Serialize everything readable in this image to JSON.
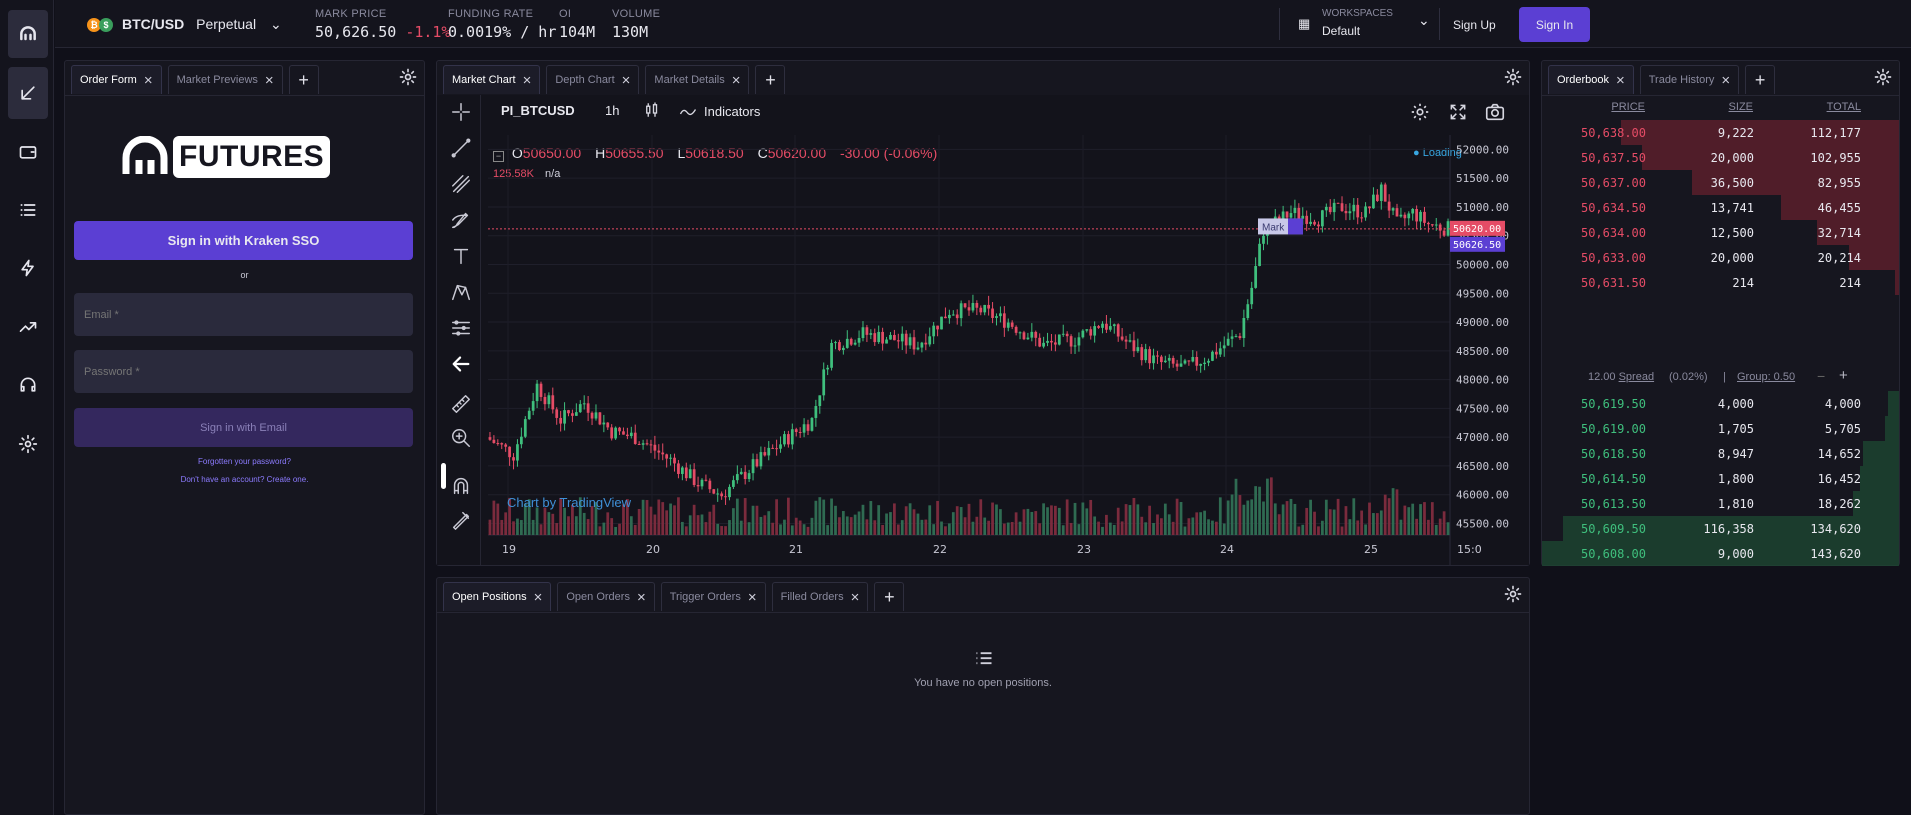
{
  "topbar": {
    "pair": "BTC/USD",
    "contract": "Perpetual",
    "stats": [
      {
        "label": "MARK PRICE",
        "value": "50,626.50",
        "change": "-1.1%"
      },
      {
        "label": "FUNDING RATE",
        "value": "0.0019% / hr"
      },
      {
        "label": "OI",
        "value": "104M"
      },
      {
        "label": "VOLUME",
        "value": "130M"
      }
    ],
    "workspaces_label": "WORKSPACES",
    "workspace": "Default",
    "signup": "Sign Up",
    "signin": "Sign In"
  },
  "left_panel": {
    "tabs": [
      {
        "label": "Order Form"
      },
      {
        "label": "Market Previews"
      }
    ],
    "logo_text": "FUTURES",
    "sso_button": "Sign in with Kraken SSO",
    "or": "or",
    "email_placeholder": "Email *",
    "password_placeholder": "Password *",
    "email_button": "Sign in with Email",
    "forgot": "Forgotten your password?",
    "no_account": "Don't have an account? Create one."
  },
  "chart_panel": {
    "tabs": [
      {
        "label": "Market Chart"
      },
      {
        "label": "Depth Chart"
      },
      {
        "label": "Market Details"
      }
    ],
    "symbol": "PI_BTCUSD",
    "interval": "1h",
    "indicators": "Indicators",
    "ohlc": {
      "o_label": "O",
      "o": "50650.00",
      "h_label": "H",
      "h": "50655.50",
      "l_label": "L",
      "l": "50618.50",
      "c_label": "C",
      "c": "50620.00",
      "chg": "-30.00 (-0.06%)"
    },
    "volume": "125.58K",
    "volume_na": "n/a",
    "loading": "Loading",
    "watermark": "Chart by TradingView",
    "mark_label": "Mark",
    "last_price_label": "50620.00",
    "mark_price_label": "50626.50",
    "y_ticks": [
      "52000.00",
      "51500.00",
      "51000.00",
      "50500.00",
      "50000.00",
      "49500.00",
      "49000.00",
      "48500.00",
      "48000.00",
      "47500.00",
      "47000.00",
      "46500.00",
      "46000.00",
      "45500.00"
    ],
    "x_ticks": [
      "19",
      "20",
      "21",
      "22",
      "23",
      "24",
      "25",
      "15:0"
    ]
  },
  "chart_data": {
    "type": "candlestick",
    "symbol": "PI_BTCUSD",
    "interval": "1h",
    "ylim": [
      45300,
      52250
    ],
    "anchors": [
      {
        "x": 0,
        "y": 47000
      },
      {
        "x": 7,
        "y": 46700
      },
      {
        "x": 13,
        "y": 47900
      },
      {
        "x": 19,
        "y": 47300
      },
      {
        "x": 25,
        "y": 47600
      },
      {
        "x": 32,
        "y": 47100
      },
      {
        "x": 38,
        "y": 47000
      },
      {
        "x": 47,
        "y": 46600
      },
      {
        "x": 54,
        "y": 46200
      },
      {
        "x": 60,
        "y": 46000
      },
      {
        "x": 68,
        "y": 46500
      },
      {
        "x": 77,
        "y": 47000
      },
      {
        "x": 83,
        "y": 47300
      },
      {
        "x": 88,
        "y": 48600
      },
      {
        "x": 96,
        "y": 48800
      },
      {
        "x": 104,
        "y": 48700
      },
      {
        "x": 110,
        "y": 48600
      },
      {
        "x": 118,
        "y": 49200
      },
      {
        "x": 126,
        "y": 49200
      },
      {
        "x": 133,
        "y": 49000
      },
      {
        "x": 142,
        "y": 48600
      },
      {
        "x": 150,
        "y": 48700
      },
      {
        "x": 157,
        "y": 49000
      },
      {
        "x": 164,
        "y": 48600
      },
      {
        "x": 171,
        "y": 48300
      },
      {
        "x": 178,
        "y": 48200
      },
      {
        "x": 184,
        "y": 48400
      },
      {
        "x": 192,
        "y": 48800
      },
      {
        "x": 195,
        "y": 49600
      },
      {
        "x": 198,
        "y": 50600
      },
      {
        "x": 205,
        "y": 50900
      },
      {
        "x": 212,
        "y": 50800
      },
      {
        "x": 218,
        "y": 51000
      },
      {
        "x": 224,
        "y": 50900
      },
      {
        "x": 228,
        "y": 51300
      },
      {
        "x": 232,
        "y": 50700
      },
      {
        "x": 236,
        "y": 50900
      },
      {
        "x": 240,
        "y": 50700
      },
      {
        "x": 245,
        "y": 50620
      }
    ],
    "candles": 245,
    "series": [
      {
        "type": "volume",
        "color_up": "#2f6b52",
        "color_down": "#7b2b3d"
      }
    ]
  },
  "orderbook": {
    "tabs": [
      {
        "label": "Orderbook"
      },
      {
        "label": "Trade History"
      }
    ],
    "columns": [
      "PRICE",
      "SIZE",
      "TOTAL"
    ],
    "asks": [
      {
        "price": "50,638.00",
        "size": "9,222",
        "total": "112,177",
        "depth": 0.78
      },
      {
        "price": "50,637.50",
        "size": "20,000",
        "total": "102,955",
        "depth": 0.72
      },
      {
        "price": "50,637.00",
        "size": "36,500",
        "total": "82,955",
        "depth": 0.58
      },
      {
        "price": "50,634.50",
        "size": "13,741",
        "total": "46,455",
        "depth": 0.33
      },
      {
        "price": "50,634.00",
        "size": "12,500",
        "total": "32,714",
        "depth": 0.23
      },
      {
        "price": "50,633.00",
        "size": "20,000",
        "total": "20,214",
        "depth": 0.14
      },
      {
        "price": "50,631.50",
        "size": "214",
        "total": "214",
        "depth": 0.01
      }
    ],
    "spread": {
      "value": "12.00",
      "label": "Spread",
      "pct": "(0.02%)",
      "sep": "|",
      "group_label": "Group: 0.50",
      "minus": "−",
      "plus": "+"
    },
    "bids": [
      {
        "price": "50,619.50",
        "size": "4,000",
        "total": "4,000",
        "depth": 0.03
      },
      {
        "price": "50,619.00",
        "size": "1,705",
        "total": "5,705",
        "depth": 0.04
      },
      {
        "price": "50,618.50",
        "size": "8,947",
        "total": "14,652",
        "depth": 0.1
      },
      {
        "price": "50,614.50",
        "size": "1,800",
        "total": "16,452",
        "depth": 0.11
      },
      {
        "price": "50,613.50",
        "size": "1,810",
        "total": "18,262",
        "depth": 0.13
      },
      {
        "price": "50,609.50",
        "size": "116,358",
        "total": "134,620",
        "depth": 0.94
      },
      {
        "price": "50,608.00",
        "size": "9,000",
        "total": "143,620",
        "depth": 1.0
      }
    ]
  },
  "positions_panel": {
    "tabs": [
      {
        "label": "Open Positions"
      },
      {
        "label": "Open Orders"
      },
      {
        "label": "Trigger Orders"
      },
      {
        "label": "Filled Orders"
      }
    ],
    "empty_text": "You have no open positions."
  },
  "colors": {
    "accent": "#5b3fd3",
    "ask": "#e54c66",
    "bid": "#3fbf7d",
    "panel": "#16161f"
  }
}
